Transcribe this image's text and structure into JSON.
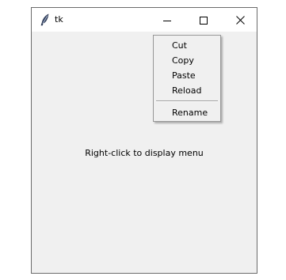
{
  "window": {
    "title": "tk",
    "app_icon": "feather-icon",
    "controls": {
      "minimize_icon": "minimize-icon",
      "maximize_icon": "maximize-icon",
      "close_icon": "close-icon"
    }
  },
  "content": {
    "hint_text": "Right-click to display menu"
  },
  "context_menu": {
    "items": [
      {
        "label": "Cut"
      },
      {
        "label": "Copy"
      },
      {
        "label": "Paste"
      },
      {
        "label": "Reload"
      },
      {
        "label": "Rename"
      }
    ]
  },
  "colors": {
    "client_background": "#f0f0f0",
    "titlebar_background": "#ffffff",
    "menu_border": "#979797"
  }
}
